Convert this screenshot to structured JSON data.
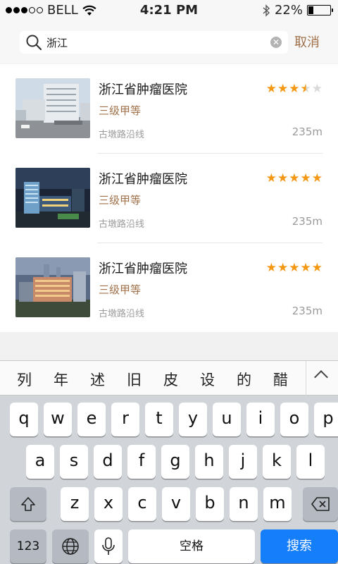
{
  "status_bar": {
    "carrier": "BELL",
    "time": "4:21 PM",
    "battery_percent": "22%",
    "battery_level": 0.22
  },
  "search": {
    "query": "浙江",
    "cancel_label": "取消"
  },
  "results": [
    {
      "name": "浙江省肿瘤医院",
      "level": "三级甲等",
      "address": "古墩路沿线",
      "distance": "235m",
      "rating": 3.5
    },
    {
      "name": "浙江省肿瘤医院",
      "level": "三级甲等",
      "address": "古墩路沿线",
      "distance": "235m",
      "rating": 5
    },
    {
      "name": "浙江省肿瘤医院",
      "level": "三级甲等",
      "address": "古墩路沿线",
      "distance": "235m",
      "rating": 5
    }
  ],
  "keyboard": {
    "candidates": [
      "列",
      "年",
      "述",
      "旧",
      "皮",
      "设",
      "的",
      "醋"
    ],
    "row1": [
      "q",
      "w",
      "e",
      "r",
      "t",
      "y",
      "u",
      "i",
      "o",
      "p"
    ],
    "row2": [
      "a",
      "s",
      "d",
      "f",
      "g",
      "h",
      "j",
      "k",
      "l"
    ],
    "row3": [
      "z",
      "x",
      "c",
      "v",
      "b",
      "n",
      "m"
    ],
    "numbers_label": "123",
    "space_label": "空格",
    "search_label": "搜索"
  },
  "colors": {
    "accent": "#a0714a",
    "star": "#f49712",
    "key_blue": "#157efb"
  }
}
